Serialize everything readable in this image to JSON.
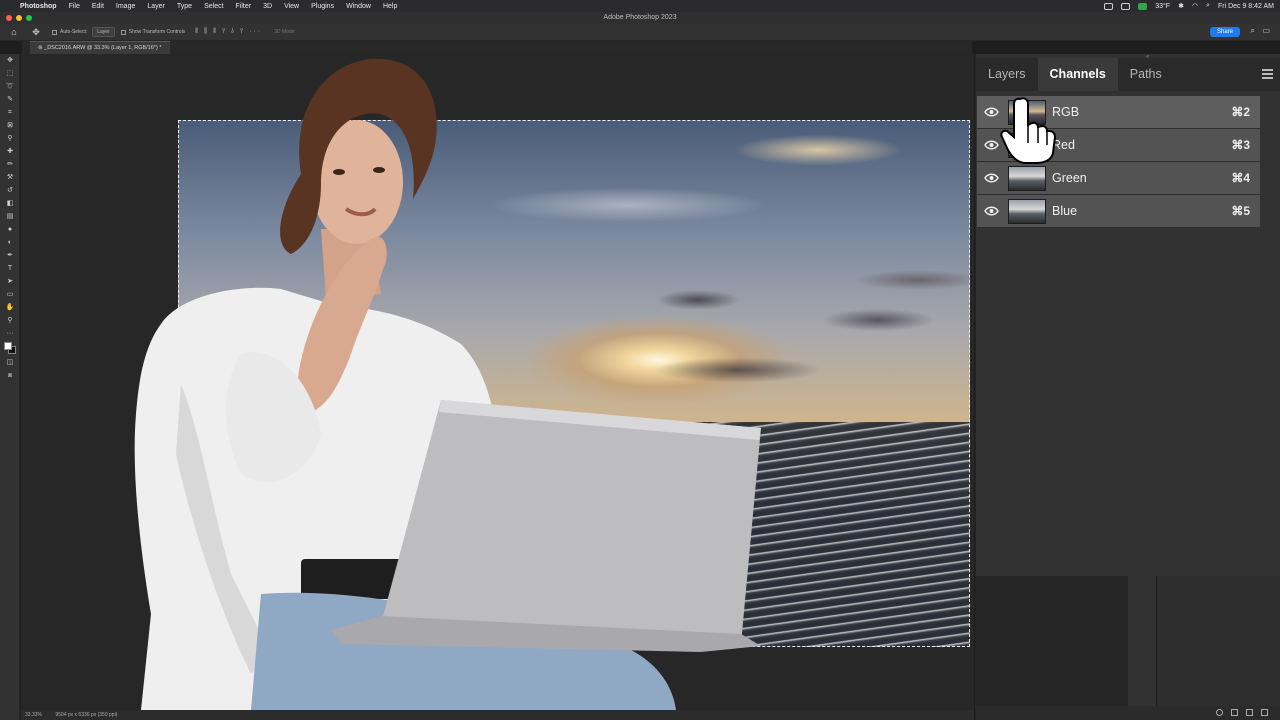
{
  "menubar": {
    "app": "Photoshop",
    "items": [
      "File",
      "Edit",
      "Image",
      "Layer",
      "Type",
      "Select",
      "Filter",
      "3D",
      "View",
      "Plugins",
      "Window",
      "Help"
    ],
    "temperature": "33°F",
    "datetime": "Fri Dec 9  8:42 AM"
  },
  "window": {
    "title": "Adobe Photoshop 2023"
  },
  "options_bar": {
    "auto_select_label": "Auto-Select:",
    "auto_select_value": "Layer",
    "transform_label": "Show Transform Controls",
    "mode_3d": "3D Mode:",
    "share_label": "Share"
  },
  "document": {
    "tab_title": "_DSC2016.ARW @ 33.3% (Layer 1, RGB/16*) *"
  },
  "status": {
    "zoom": "33.33%",
    "info": "9504 px x 6336 px (350 ppi)"
  },
  "panel": {
    "tabs": [
      {
        "label": "Layers",
        "active": false
      },
      {
        "label": "Channels",
        "active": true
      },
      {
        "label": "Paths",
        "active": false
      }
    ],
    "channels": [
      {
        "name": "RGB",
        "shortcut": "⌘2"
      },
      {
        "name": "Red",
        "shortcut": "⌘3"
      },
      {
        "name": "Green",
        "shortcut": "⌘4"
      },
      {
        "name": "Blue",
        "shortcut": "⌘5"
      }
    ]
  },
  "colors": {
    "share": "#1f7af0",
    "panel": "#323232",
    "canvas": "#272727"
  }
}
